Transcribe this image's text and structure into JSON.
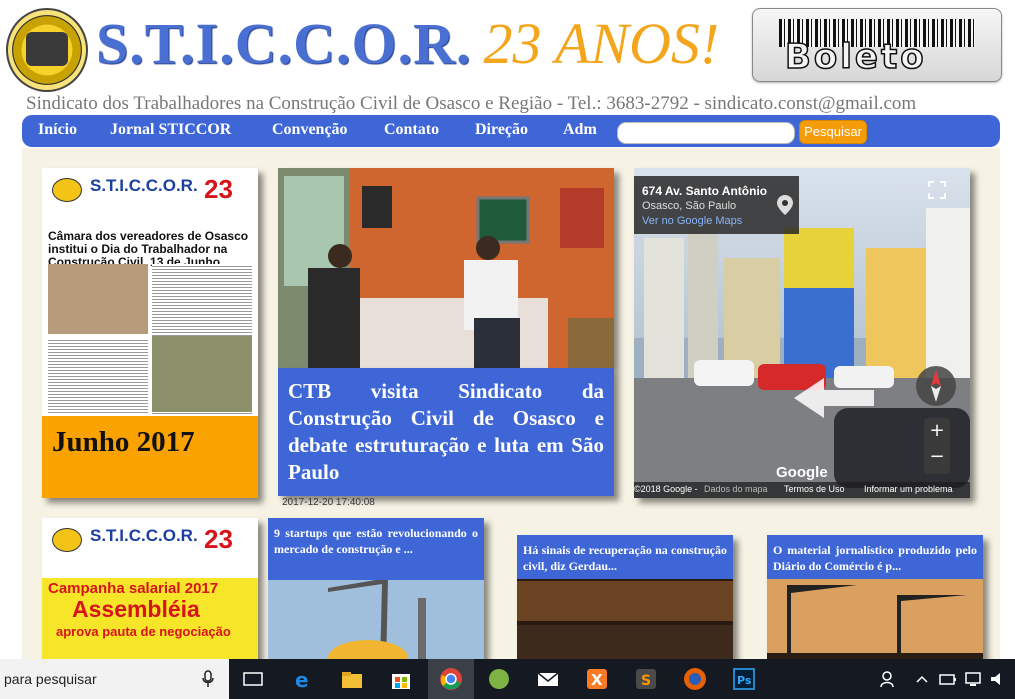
{
  "header": {
    "site_title": "S.T.I.C.C.O.R.",
    "anniversary": "23 ANOS!",
    "boleto_label": "Boleto",
    "subtitle": "Sindicato dos Trabalhadores na Construção Civil de Osasco e Região - Tel.: 3683-2792 - sindicato.const@gmail.com"
  },
  "nav": {
    "items": [
      "Início",
      "Jornal STICCOR",
      "Convenção",
      "Contato",
      "Direção",
      "Adm"
    ],
    "search_button": "Pesquisar",
    "search_value": ""
  },
  "jornal1": {
    "caption": "Junho 2017",
    "np_name": "S.T.I.C.C.O.R.",
    "np_number": "23",
    "np_headline": "Câmara dos vereadores de Osasco institui o Dia do Trabalhador na Construção Civil, 13 de Junho"
  },
  "main_news": {
    "title": "CTB visita Sindicato da Construção Civil de Osasco e debate estruturação e luta em São Paulo",
    "date": "2017-12-20 17:40:08"
  },
  "map": {
    "address": "674 Av. Santo Antônio",
    "city": "Osasco, São Paulo",
    "link": "Ver no Google Maps",
    "footer": [
      "©2018 Google -",
      "Dados do mapa",
      "Termos de Uso",
      "Informar um problema"
    ],
    "brand": "Google"
  },
  "jornal2": {
    "np_name": "S.T.I.C.C.O.R.",
    "np_number": "23",
    "headline_1": "Campanha salarial 2017",
    "headline_2": "Assembléia",
    "headline_3": "aprova pauta de negociação"
  },
  "cards": [
    {
      "title": "9 startups que estão revolucionando o mercado de construção e ..."
    },
    {
      "title": "Há sinais de recuperação na construção civil, diz Gerdau..."
    },
    {
      "title": "O material jornalístico produzido pelo Diário do Comércio é p..."
    }
  ],
  "taskbar": {
    "search_placeholder": "para pesquisar"
  },
  "colors": {
    "nav_blue": "#3e66d6",
    "orange": "#f9a200",
    "background": "#f7f3e4"
  }
}
